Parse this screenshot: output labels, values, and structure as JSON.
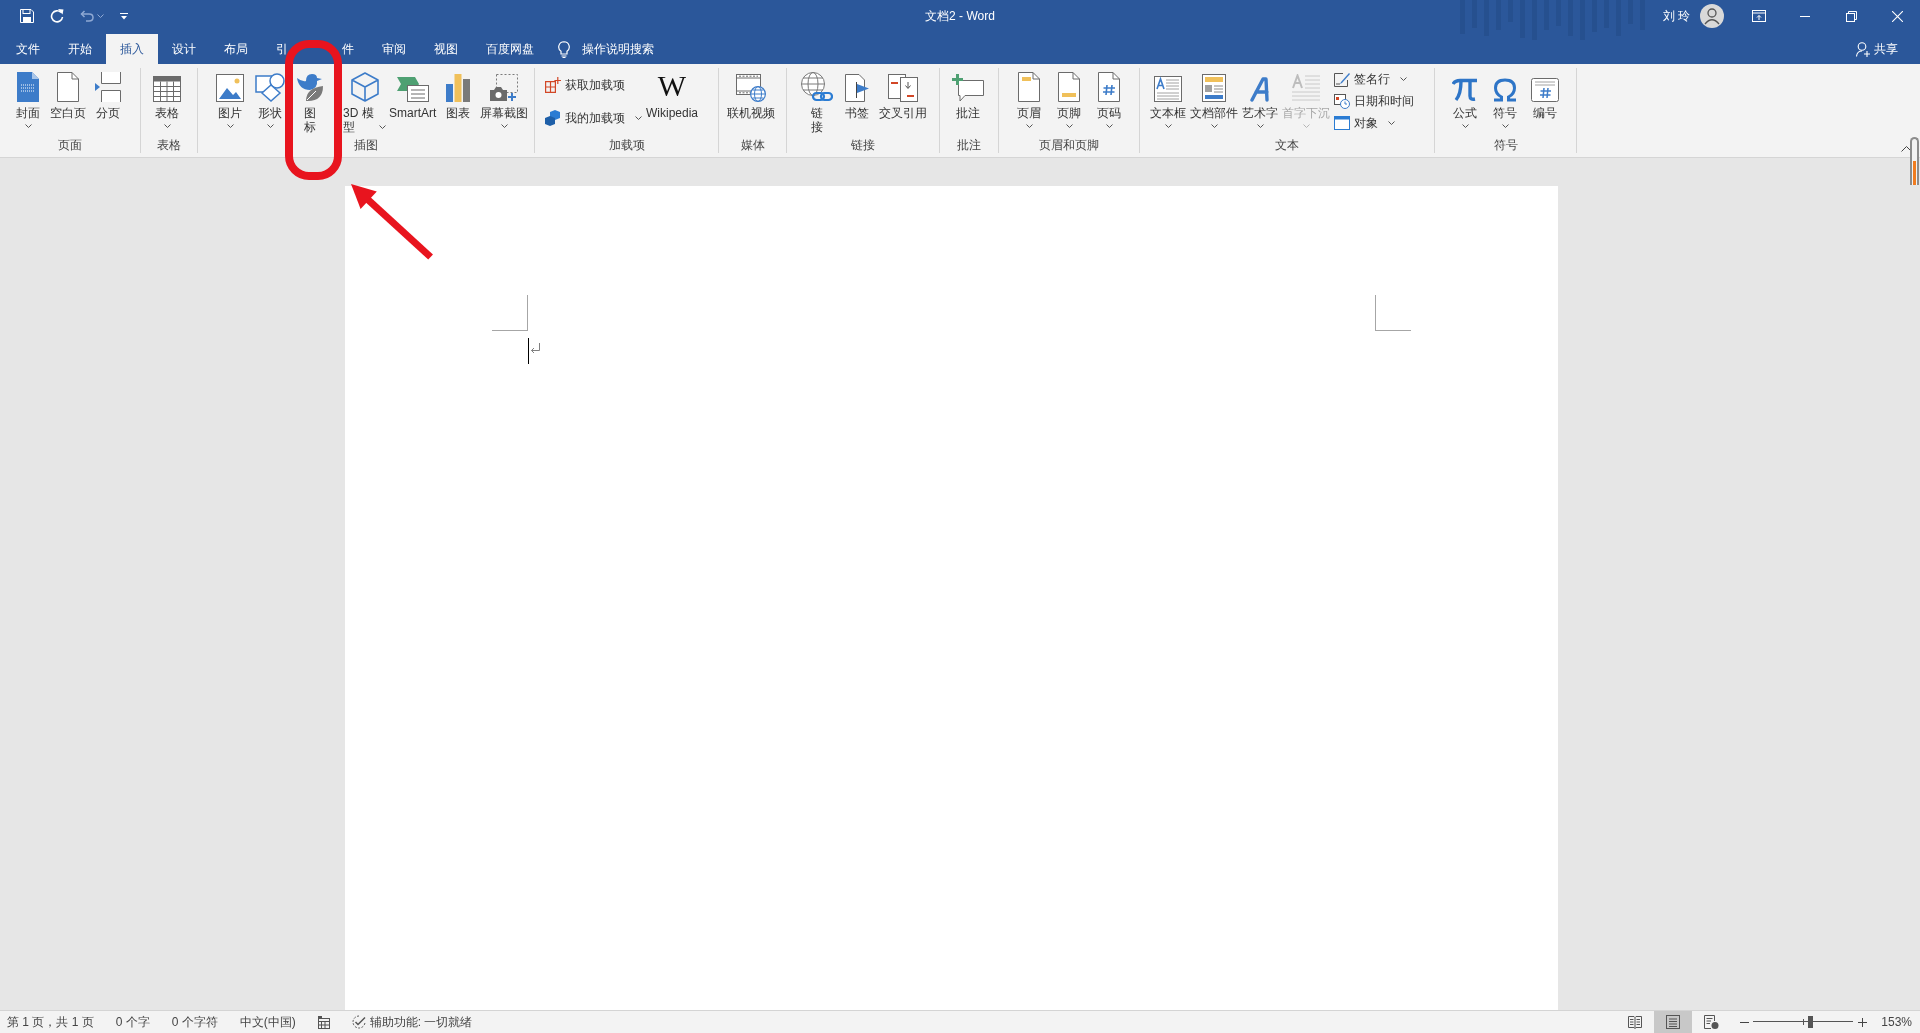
{
  "window": {
    "title": "文档2 - Word",
    "user": "刘 玲"
  },
  "quick_access": [
    {
      "kind": "save",
      "disabled": false
    },
    {
      "kind": "repeat",
      "disabled": false
    },
    {
      "kind": "undo",
      "disabled": true
    },
    {
      "kind": "customize",
      "disabled": false
    }
  ],
  "tabs": [
    {
      "label": "文件",
      "selected": false
    },
    {
      "label": "开始",
      "selected": false
    },
    {
      "label": "插入",
      "selected": true
    },
    {
      "label": "设计",
      "selected": false
    },
    {
      "label": "布局",
      "selected": false
    },
    {
      "label": "引",
      "selected": false
    },
    {
      "label": "件",
      "selected": false
    },
    {
      "label": "审阅",
      "selected": false
    },
    {
      "label": "视图",
      "selected": false
    },
    {
      "label": "百度网盘",
      "selected": false
    }
  ],
  "tell_me": {
    "label": "操作说明搜索"
  },
  "share": {
    "label": "共享"
  },
  "ribbon": {
    "groups": [
      {
        "label": "页面",
        "items": [
          {
            "kind": "large",
            "label": "封面",
            "dropdown": true,
            "disabled": false
          },
          {
            "kind": "large",
            "label": "空白页",
            "dropdown": false,
            "disabled": false
          },
          {
            "kind": "large",
            "label": "分页",
            "dropdown": false,
            "disabled": false
          }
        ]
      },
      {
        "label": "表格",
        "items": [
          {
            "kind": "large",
            "label": "表格",
            "dropdown": true,
            "disabled": false
          }
        ]
      },
      {
        "label": "插图",
        "items": [
          {
            "kind": "large",
            "label": "图片",
            "dropdown": true,
            "disabled": false
          },
          {
            "kind": "large",
            "label": "形状",
            "dropdown": true,
            "disabled": false
          },
          {
            "kind": "large",
            "label": "图标",
            "dropdown": false,
            "disabled": false
          },
          {
            "kind": "large",
            "label": "3D 模型",
            "dropdown": true,
            "disabled": false
          },
          {
            "kind": "large",
            "label": "SmartArt",
            "dropdown": false,
            "disabled": false
          },
          {
            "kind": "large",
            "label": "图表",
            "dropdown": false,
            "disabled": false
          },
          {
            "kind": "large",
            "label": "屏幕截图",
            "dropdown": true,
            "disabled": false
          }
        ]
      },
      {
        "label": "加载项",
        "items": [
          {
            "kind": "small",
            "label": "获取加载项",
            "dropdown": false,
            "disabled": false
          },
          {
            "kind": "small",
            "label": "我的加载项",
            "dropdown": true,
            "disabled": false
          },
          {
            "kind": "glyph",
            "label": "Wikipedia",
            "glyph": "W",
            "dropdown": false,
            "disabled": false
          }
        ]
      },
      {
        "label": "媒体",
        "items": [
          {
            "kind": "large",
            "label": "联机视频",
            "dropdown": false,
            "disabled": false
          }
        ]
      },
      {
        "label": "链接",
        "items": [
          {
            "kind": "large",
            "label": "链接",
            "dropdown": false,
            "disabled": false
          },
          {
            "kind": "large",
            "label": "书签",
            "dropdown": false,
            "disabled": false
          },
          {
            "kind": "large",
            "label": "交叉引用",
            "dropdown": false,
            "disabled": false
          }
        ]
      },
      {
        "label": "批注",
        "items": [
          {
            "kind": "large",
            "label": "批注",
            "dropdown": false,
            "disabled": false
          }
        ]
      },
      {
        "label": "页眉和页脚",
        "items": [
          {
            "kind": "large",
            "label": "页眉",
            "dropdown": true,
            "disabled": false
          },
          {
            "kind": "large",
            "label": "页脚",
            "dropdown": true,
            "disabled": false
          },
          {
            "kind": "large",
            "label": "页码",
            "dropdown": true,
            "disabled": false
          }
        ]
      },
      {
        "label": "文本",
        "items": [
          {
            "kind": "large",
            "label": "文本框",
            "dropdown": true,
            "disabled": false
          },
          {
            "kind": "large",
            "label": "文档部件",
            "dropdown": true,
            "disabled": false
          },
          {
            "kind": "large",
            "label": "艺术字",
            "dropdown": true,
            "disabled": false
          },
          {
            "kind": "large",
            "label": "首字下沉",
            "dropdown": true,
            "disabled": true
          },
          {
            "kind": "small",
            "label": "签名行",
            "dropdown": true,
            "disabled": false
          },
          {
            "kind": "small",
            "label": "日期和时间",
            "dropdown": false,
            "disabled": false
          },
          {
            "kind": "small",
            "label": "对象",
            "dropdown": true,
            "disabled": false
          }
        ]
      },
      {
        "label": "符号",
        "items": [
          {
            "kind": "large",
            "label": "公式",
            "dropdown": true,
            "disabled": false
          },
          {
            "kind": "large",
            "label": "符号",
            "dropdown": true,
            "disabled": false
          },
          {
            "kind": "large",
            "label": "编号",
            "dropdown": false,
            "disabled": false
          }
        ]
      }
    ]
  },
  "status_bar": {
    "page": "第 1 页，共 1 页",
    "words": "0 个字",
    "characters": "0 个字符",
    "language": "中文(中国)",
    "accessibility": "辅助功能: 一切就绪",
    "views": [
      {
        "kind": "read",
        "selected": false
      },
      {
        "kind": "print",
        "selected": true
      },
      {
        "kind": "web",
        "selected": false
      }
    ],
    "zoom": {
      "level": 0.57,
      "reading": "153%"
    }
  }
}
